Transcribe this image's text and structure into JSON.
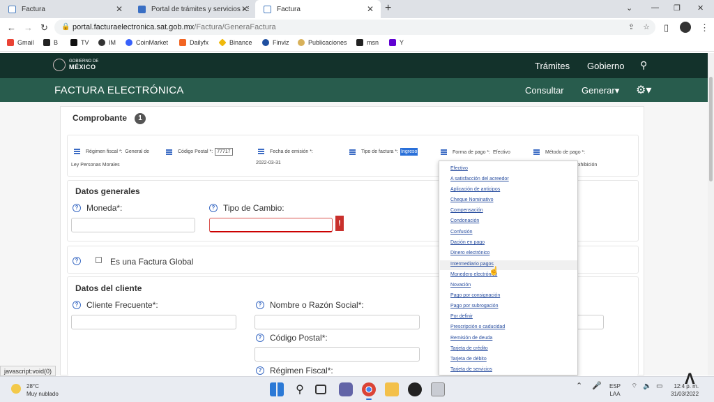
{
  "browser": {
    "tabs": [
      {
        "title": "Factura"
      },
      {
        "title": "Portal de trámites y servicios - SA"
      },
      {
        "title": "Factura"
      }
    ],
    "url_host": "portal.facturaelectronica.sat.gob.mx",
    "url_path": "/Factura/GeneraFactura",
    "bookmarks": [
      "Gmail",
      "B",
      "TV",
      "IM",
      "CoinMarket",
      "Dailyfx",
      "Binance",
      "Finviz",
      "Publicaciones",
      "msn",
      "Y"
    ]
  },
  "gob_header": {
    "logo_line1": "GOBIERNO DE",
    "logo_line2": "MÉXICO",
    "tramites": "Trámites",
    "gobierno": "Gobierno"
  },
  "fact_header": {
    "title": "FACTURA ELECTRÓNICA",
    "consultar": "Consultar",
    "generar": "Generar▾"
  },
  "comprobante": {
    "title": "Comprobante",
    "step": "1",
    "regimen_label": "Régimen fiscal *:",
    "regimen_value_a": "General de",
    "regimen_value_b": "Ley Personas Morales",
    "cp_label": "Código Postal *:",
    "cp_value": "77717",
    "fecha_label": "Fecha de emisión *:",
    "fecha_value": "2022-03-31",
    "tipo_label": "Tipo de factura *:",
    "tipo_value": "Ingreso",
    "forma_label": "Forma de pago *:",
    "forma_value": "Efectivo",
    "metodo_label": "Método de pago *:",
    "metodo_value_partial": "xhibición"
  },
  "datos_generales": {
    "title": "Datos generales",
    "moneda_label": "Moneda*:",
    "tipo_cambio_label": "Tipo de Cambio:",
    "error_mark": "!",
    "factura_global_label": "Es una Factura Global"
  },
  "datos_cliente": {
    "title": "Datos del cliente",
    "cliente_label": "Cliente Frecuente*:",
    "nombre_label": "Nombre o Razón Social*:",
    "cp_label": "Código Postal*:",
    "regimen_label": "Régimen Fiscal*:"
  },
  "forma_pago_options": [
    "Efectivo",
    "A satisfacción del acreedor",
    "Aplicación de anticipos",
    "Cheque Nominativo",
    "Compensación",
    "Condonación",
    "Confusión",
    "Dación en pago",
    "Dinero electrónico",
    "Intermediario pagos",
    "Monedero electrónico",
    "Novación",
    "Pago por consignación",
    "Pago por subrogación",
    "Por definir",
    "Prescripción o caducidad",
    "Remisión de deuda",
    "Tarjeta de crédito",
    "Tarjeta de débito",
    "Tarjeta de servicios"
  ],
  "status_text": "javascript:void(0)",
  "taskbar": {
    "temp": "28°C",
    "weather": "Muy nublado",
    "lang1": "ESP",
    "lang2": "LAA",
    "time": "12:4  p. m.",
    "date": "31/03/2022"
  }
}
